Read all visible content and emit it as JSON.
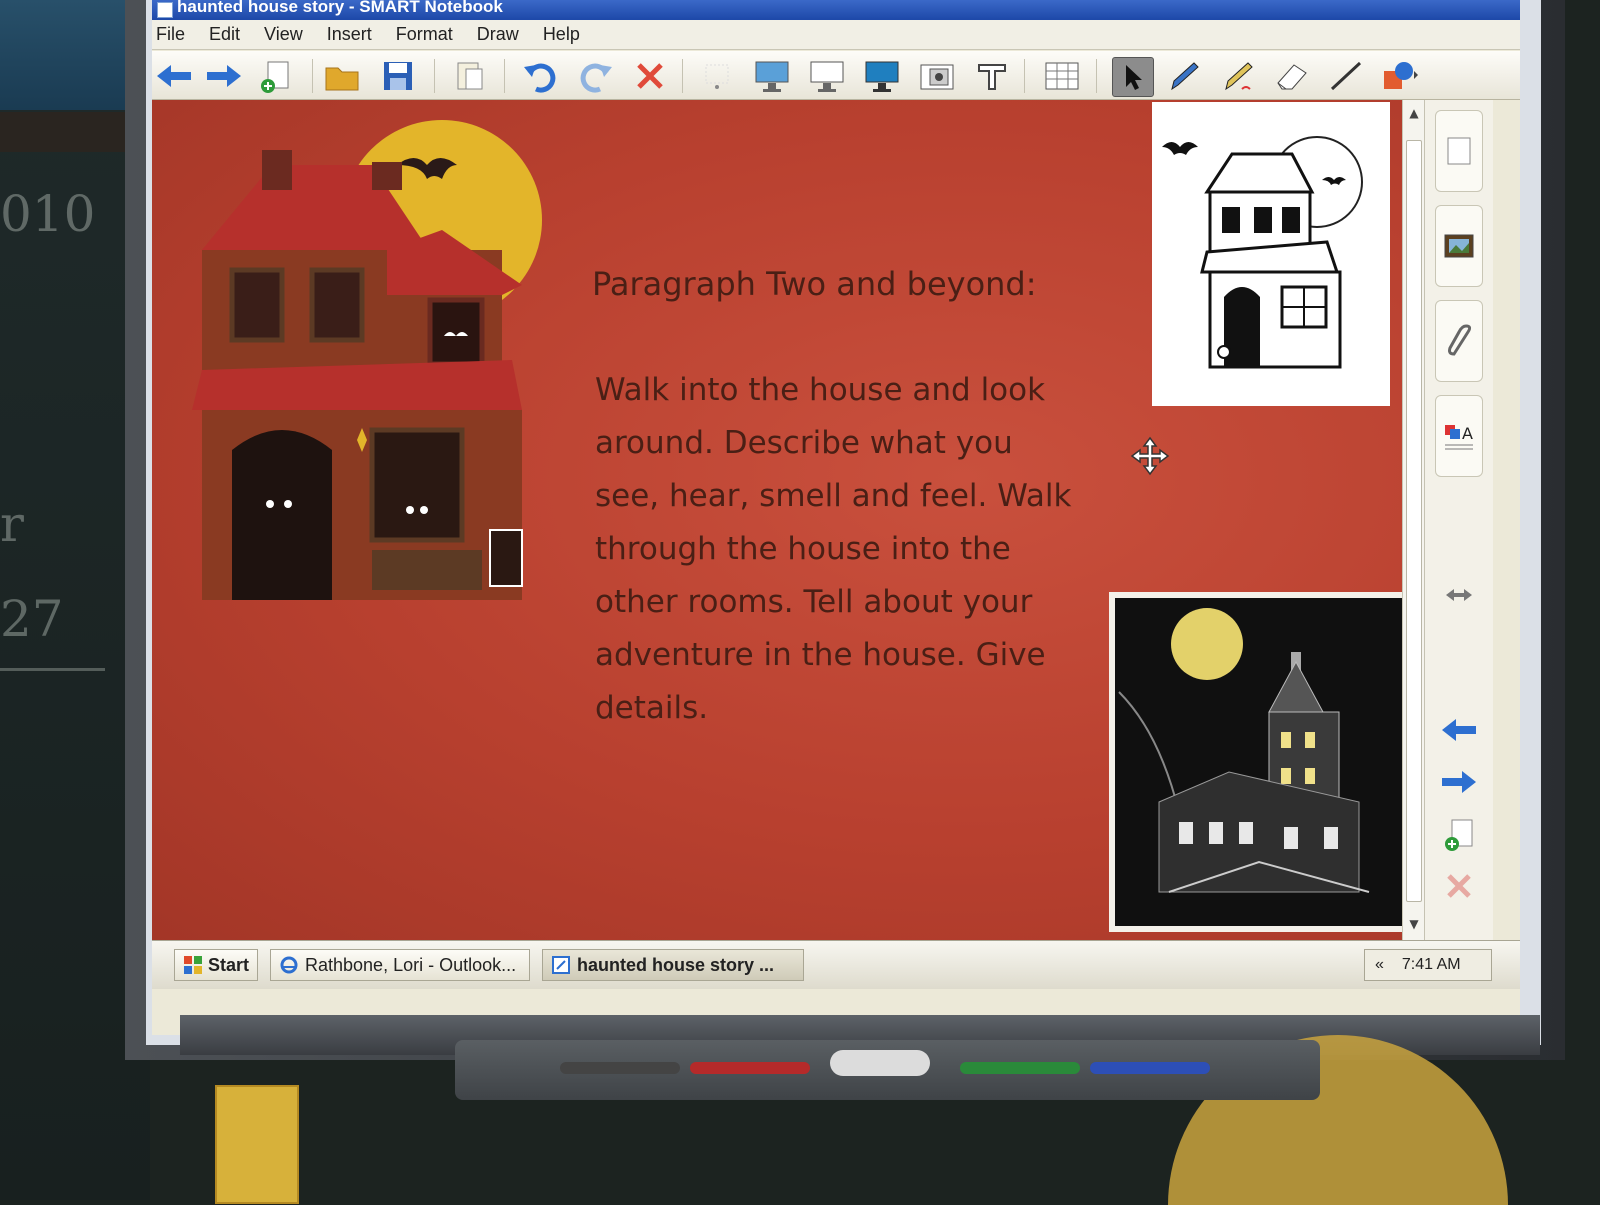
{
  "window": {
    "title": "haunted house story - SMART Notebook"
  },
  "menu": [
    "File",
    "Edit",
    "View",
    "Insert",
    "Format",
    "Draw",
    "Help"
  ],
  "toolbar_icons": [
    "back-arrow-icon",
    "forward-arrow-icon",
    "add-page-icon",
    "open-folder-icon",
    "save-icon",
    "paste-icon",
    "undo-icon",
    "redo-icon",
    "delete-icon",
    "screen-shade-icon",
    "full-screen-icon",
    "blank-screen-icon",
    "display-icon",
    "capture-icon",
    "text-tool-icon",
    "table-icon",
    "select-arrow-icon",
    "pen-icon",
    "creative-pen-icon",
    "eraser-icon",
    "line-icon",
    "shape-icon"
  ],
  "slide": {
    "heading": "Paragraph Two and beyond:",
    "body": "Walk into the house and look\naround.  Describe what you\nsee, hear, smell and feel. Walk\nthrough the house into the\nother rooms.  Tell about your\nadventure in the house.  Give\ndetails."
  },
  "side_tabs": [
    "page-sorter-icon",
    "gallery-icon",
    "attachments-icon",
    "properties-icon"
  ],
  "taskbar": {
    "start_label": "Start",
    "tasks": [
      {
        "label": "Rathbone, Lori - Outlook..."
      },
      {
        "label": "haunted house story ..."
      }
    ],
    "tray_chevron": "«",
    "clock": "7:41 AM"
  },
  "colors": {
    "page_background": "#b8402f",
    "text": "#4a1f15",
    "title_bar": "#1d48a8"
  }
}
